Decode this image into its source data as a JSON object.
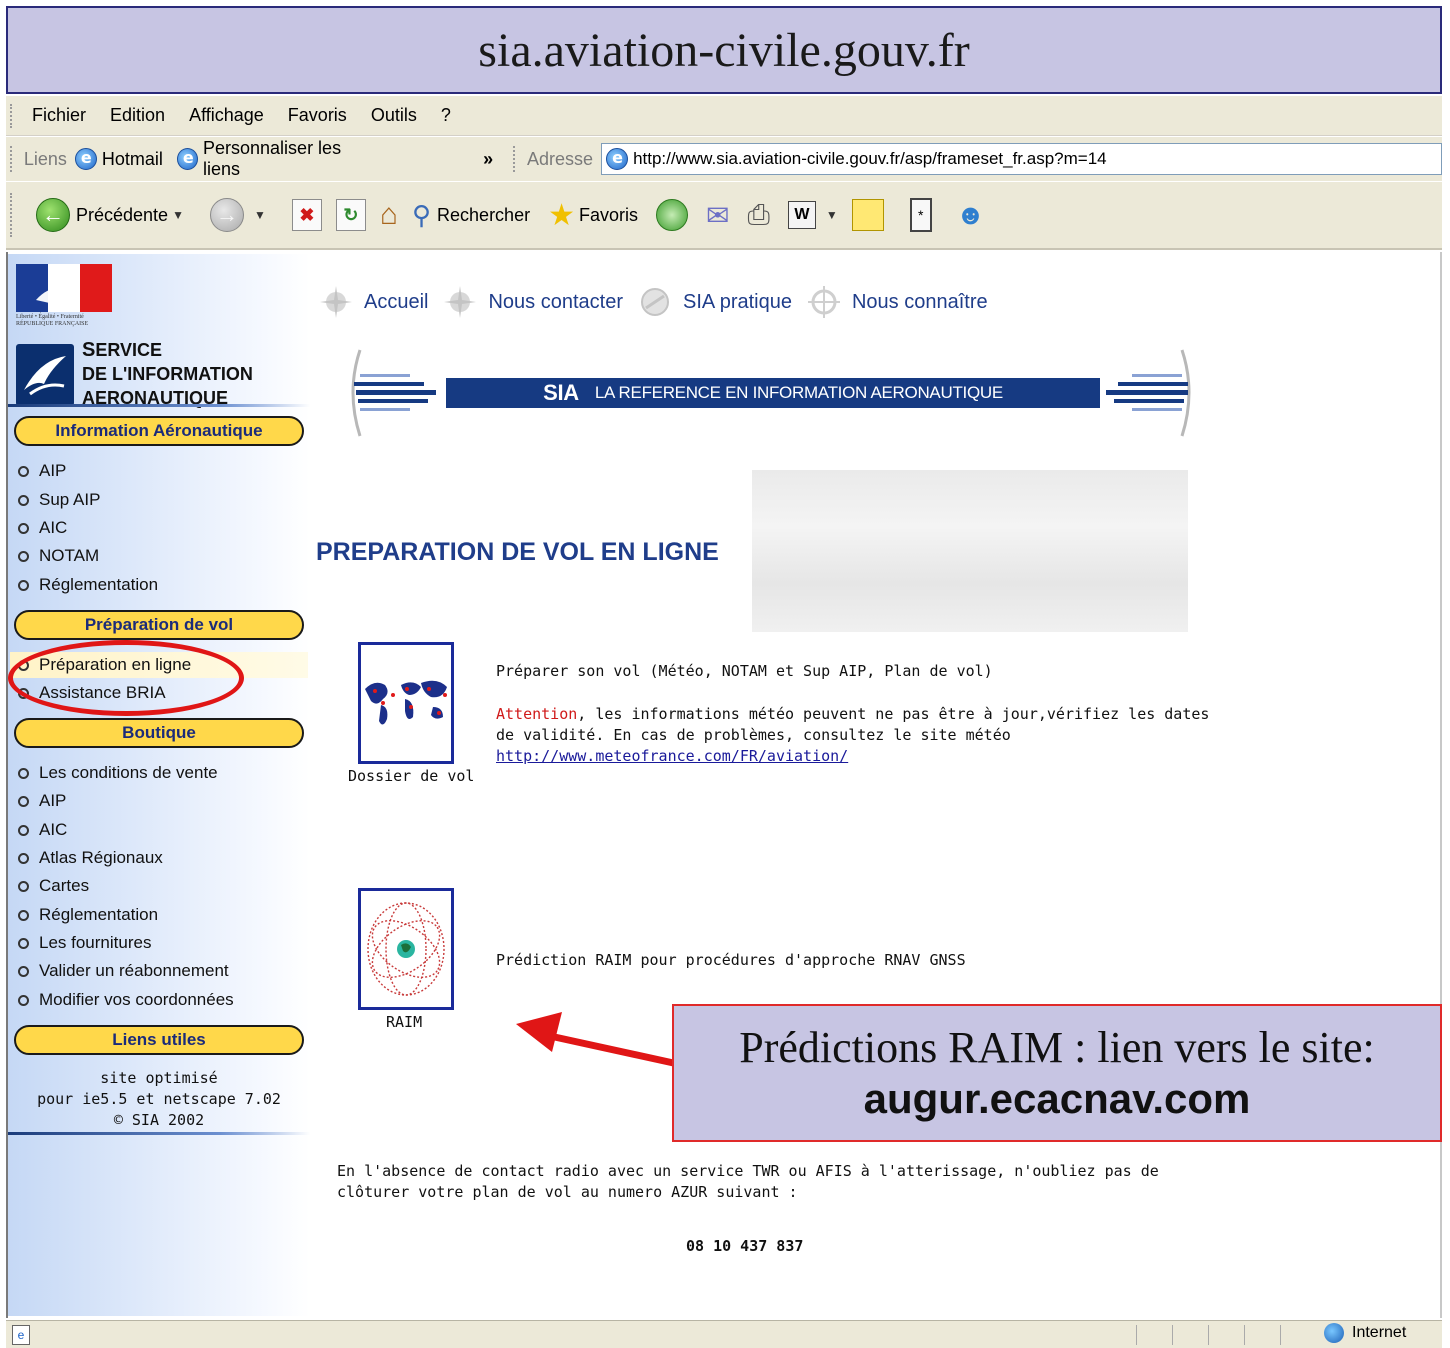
{
  "banner": {
    "title": "sia.aviation-civile.gouv.fr"
  },
  "menubar": {
    "items": [
      "Fichier",
      "Edition",
      "Affichage",
      "Favoris",
      "Outils",
      "?"
    ]
  },
  "linksbar": {
    "label": "Liens",
    "links": [
      "Hotmail",
      "Personnaliser les liens"
    ],
    "more": "»",
    "address_label": "Adresse",
    "address_value": "http://www.sia.aviation-civile.gouv.fr/asp/frameset_fr.asp?m=14"
  },
  "toolbar": {
    "back_label": "Précédente",
    "search_label": "Rechercher",
    "favorites_label": "Favoris"
  },
  "logo": {
    "rf_caption_1": "Liberté • Égalité • Fraternité",
    "rf_caption_2": "RÉPUBLIQUE FRANÇAISE",
    "name_1a": "S",
    "name_1b": "ERVICE",
    "name_2": "DE L'INFORMATION",
    "name_3": "AERONAUTIQUE"
  },
  "sidebar": {
    "sections": [
      {
        "title": "Information Aéronautique",
        "items": [
          "AIP",
          "Sup AIP",
          "AIC",
          "NOTAM",
          "Réglementation"
        ]
      },
      {
        "title": "Préparation de vol",
        "items": [
          "Préparation en ligne",
          "Assistance BRIA"
        ]
      },
      {
        "title": "Boutique",
        "items": [
          "Les conditions de vente",
          "AIP",
          "AIC",
          "Atlas Régionaux",
          "Cartes",
          "Réglementation",
          "Les fournitures",
          "Valider un réabonnement",
          "Modifier vos coordonnées"
        ]
      },
      {
        "title": "Liens utiles",
        "items": []
      }
    ],
    "active_item": "Préparation en ligne",
    "footer": [
      "site optimisé",
      "pour ie5.5 et netscape 7.02",
      "© SIA 2002"
    ]
  },
  "topnav": {
    "items": [
      "Accueil",
      "Nous contacter",
      "SIA pratique",
      "Nous connaître"
    ]
  },
  "sia_banner": {
    "acronym": "SIA",
    "tagline": "LA REFERENCE EN INFORMATION AERONAUTIQUE"
  },
  "content": {
    "heading": "PREPARATION DE VOL EN LIGNE",
    "dossier": {
      "caption": "Dossier de vol",
      "description": "Préparer son vol (Météo, NOTAM et Sup AIP, Plan de vol)",
      "warning_word": "Attention",
      "warning_rest_1": ", les informations météo peuvent ne pas être à jour,vérifiez les dates",
      "warning_rest_2": "de validité. En cas de problèmes, consultez le site météo",
      "link": "http://www.meteofrance.com/FR/aviation/"
    },
    "raim": {
      "caption": "RAIM",
      "description": "Prédiction RAIM pour procédures d'approche RNAV GNSS"
    },
    "closing_1": "En l'absence de contact radio avec un service TWR ou AFIS à l'atterissage, n'oubliez pas de",
    "closing_2": "clôturer votre plan de vol au numero AZUR suivant :",
    "phone": "08 10 437 837"
  },
  "callout": {
    "line1": "Prédictions RAIM : lien vers le site:",
    "line2": "augur.ecacnav.com"
  },
  "statusbar": {
    "zone": "Internet"
  },
  "colors": {
    "accent_blue": "#1f3d8a",
    "pill_yellow": "#ffd84a",
    "annotation_red": "#e01616",
    "banner_purple": "#c7c5e3"
  }
}
